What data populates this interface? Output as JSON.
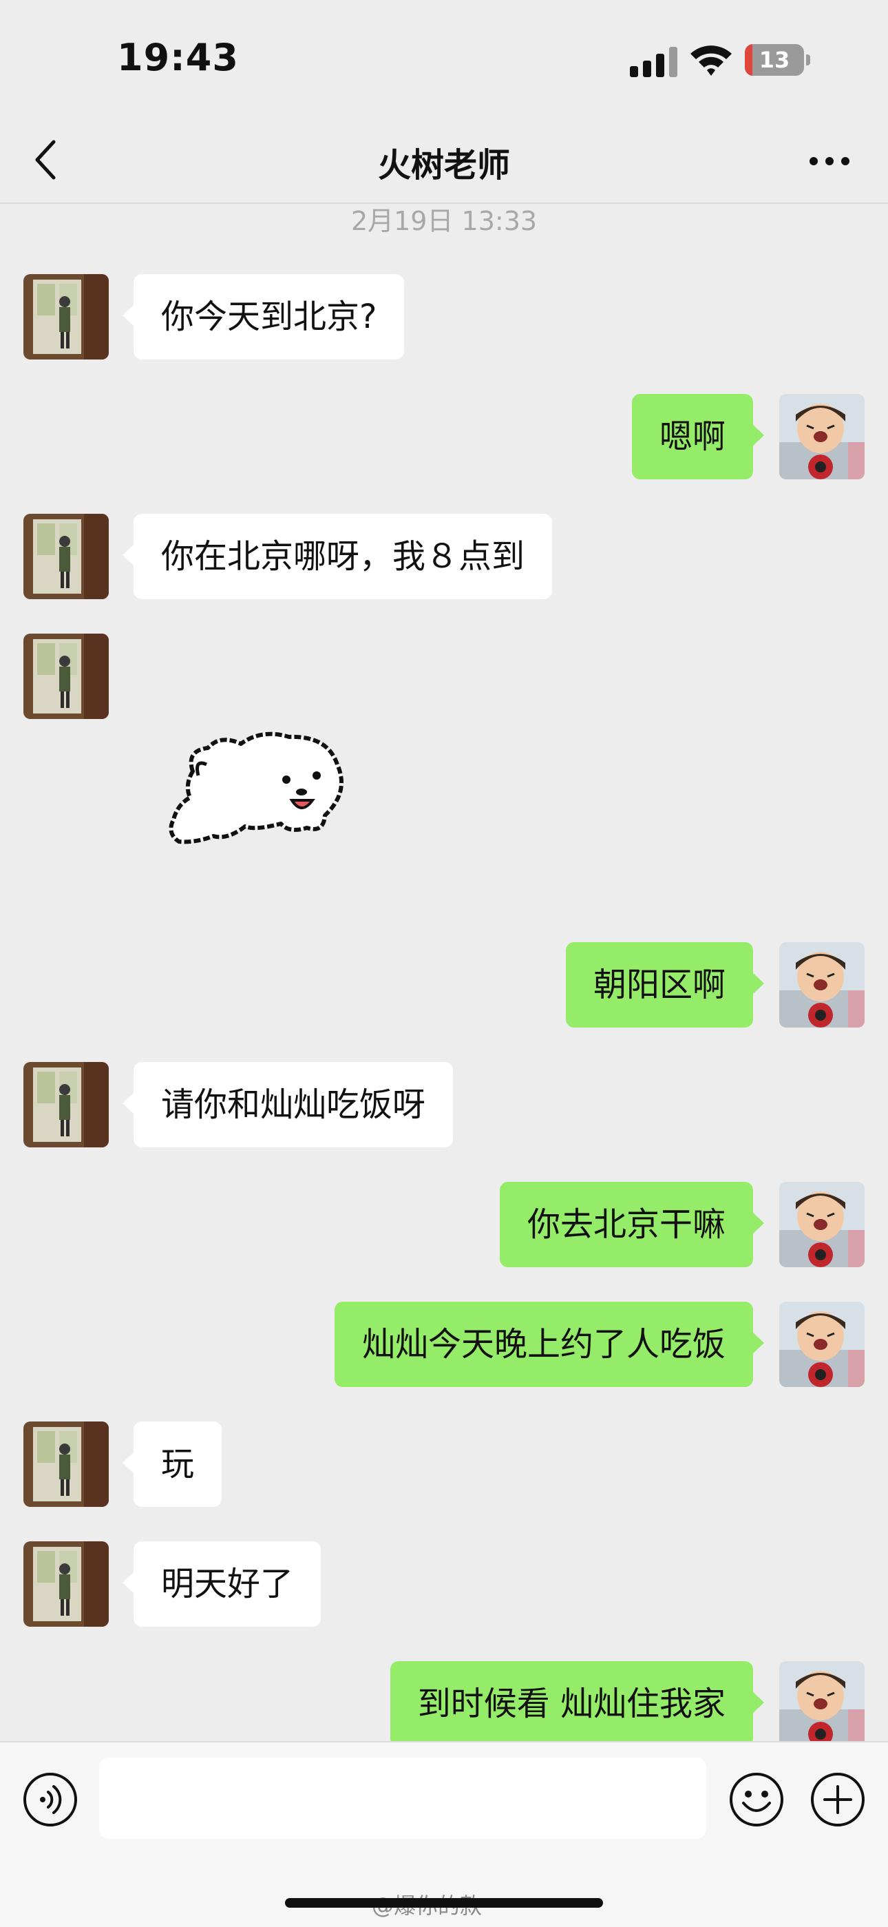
{
  "status_bar": {
    "time": "19:43",
    "battery_level": "13",
    "battery_color": "#e0463b"
  },
  "header": {
    "title": "火树老师"
  },
  "chat": {
    "timestamp": "2月19日 13:33",
    "messages": [
      {
        "side": "left",
        "type": "text",
        "text": "你今天到北京?"
      },
      {
        "side": "right",
        "type": "text",
        "text": "嗯啊"
      },
      {
        "side": "left",
        "type": "text",
        "text": "你在北京哪呀，我８点到"
      },
      {
        "side": "left",
        "type": "sticker",
        "sticker": "white-dog-sticker"
      },
      {
        "side": "right",
        "type": "text",
        "text": "朝阳区啊"
      },
      {
        "side": "left",
        "type": "text",
        "text": "请你和灿灿吃饭呀"
      },
      {
        "side": "right",
        "type": "text",
        "text": "你去北京干嘛"
      },
      {
        "side": "right",
        "type": "text",
        "text": "灿灿今天晚上约了人吃饭"
      },
      {
        "side": "left",
        "type": "text",
        "text": "玩"
      },
      {
        "side": "left",
        "type": "text",
        "text": "明天好了"
      },
      {
        "side": "right",
        "type": "text",
        "text": "到时候看 灿灿住我家"
      }
    ]
  },
  "input_bar": {
    "voice_icon": "voice-icon",
    "emoji_icon": "emoji-icon",
    "plus_icon": "plus-icon"
  },
  "watermark": {
    "text": "@爆你的款"
  },
  "colors": {
    "background": "#ededed",
    "self_bubble": "#95ec69",
    "other_bubble": "#ffffff"
  }
}
